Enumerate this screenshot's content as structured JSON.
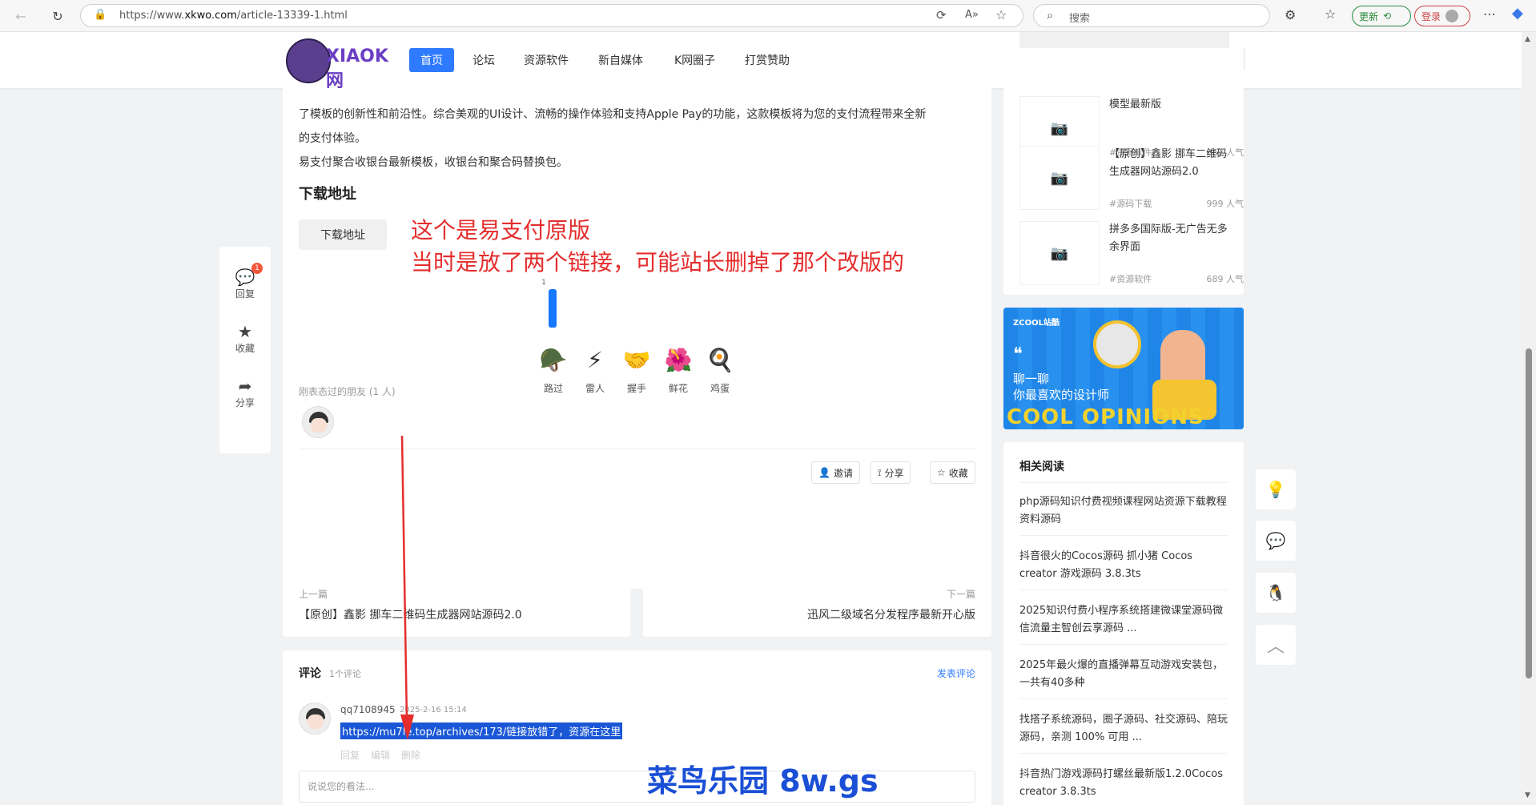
{
  "browser": {
    "url_prefix": "https://www.",
    "url_domain": "xkwo.com",
    "url_path": "/article-13339-1.html",
    "search_placeholder": "搜索",
    "update_label": "更新",
    "login_label": "登录"
  },
  "header": {
    "logo_text": "XIAOK网",
    "nav": [
      "首页",
      "论坛",
      "资源软件",
      "新自媒体",
      "K网圈子",
      "打赏赞助"
    ]
  },
  "article": {
    "para1": "了模板的创新性和前沿性。综合美观的UI设计、流畅的操作体验和支持Apple Pay的功能，这款模板将为您的支付流程带来全新",
    "para2": "的支付体验。",
    "para3": "易支付聚合收银台最新模板，收银台和聚合码替换包。",
    "download_heading": "下载地址",
    "download_button": "下载地址",
    "note_line1": "这个是易支付原版",
    "note_line2": "当时是放了两个链接，可能站长删掉了那个改版的",
    "bar_count": "1",
    "reactions": [
      {
        "emoji": "🪖",
        "label": "路过"
      },
      {
        "emoji": "⚡",
        "label": "雷人"
      },
      {
        "emoji": "🤝",
        "label": "握手"
      },
      {
        "emoji": "🌺",
        "label": "鲜花"
      },
      {
        "emoji": "🍳",
        "label": "鸡蛋"
      }
    ],
    "friends_label": "刚表态过的朋友 (1 人)",
    "invite_label": "邀请",
    "share_label": "分享",
    "fav_label": "收藏"
  },
  "side_actions": [
    {
      "label": "回复",
      "badge": "1"
    },
    {
      "label": "收藏"
    },
    {
      "label": "分享"
    }
  ],
  "prevnext": {
    "prev_label": "上一篇",
    "prev_title": "【原创】鑫影 挪车二维码生成器网站源码2.0",
    "next_label": "下一篇",
    "next_title": "迅风二级域名分发程序最新开心版"
  },
  "comments": {
    "title": "评论",
    "count": "1个评论",
    "post_link": "发表评论",
    "user": "qq7108945",
    "time": "2025-2-16 15:14",
    "text": "https://mu7le.top/archives/173/链接放错了，资源在这里",
    "actions": [
      "回复",
      "编辑",
      "删除"
    ],
    "input_placeholder": "说说您的看法..."
  },
  "watermark": "菜鸟乐园 8w.gs",
  "right_posts": [
    {
      "title": "模型最新版",
      "cat": "#资源软件",
      "views": "861 人气"
    },
    {
      "title": "【原创】鑫影 挪车二维码生成器网站源码2.0",
      "cat": "#源码下载",
      "views": "999 人气"
    },
    {
      "title": "拼多多国际版-无广告无多余界面",
      "cat": "#资源软件",
      "views": "689 人气"
    }
  ],
  "banner": {
    "brand": "ZCOOL站酷",
    "line1": "聊一聊",
    "line2": "你最喜欢的设计师",
    "big": "COOL OPINIONS"
  },
  "related": {
    "title": "相关阅读",
    "items": [
      "php源码知识付费视频课程网站资源下载教程资料源码",
      "抖音很火的Cocos源码 抓小猪 Cocos creator 游戏源码 3.8.3ts",
      "2025知识付费小程序系统搭建微课堂源码微信流量主智创云享源码 ...",
      "2025年最火爆的直播弹幕互动游戏安装包，一共有40多种",
      "找搭子系统源码，圈子源码、社交源码、陪玩源码，亲测 100% 可用 ...",
      "抖音热门游戏源码打螺丝最新版1.2.0Cocos creator 3.8.3ts"
    ]
  },
  "colors": {
    "accent": "#2f7bff",
    "note_red": "#e52d2d",
    "watermark_blue": "#1a4fd6",
    "watermark_red": "#e0241b"
  }
}
